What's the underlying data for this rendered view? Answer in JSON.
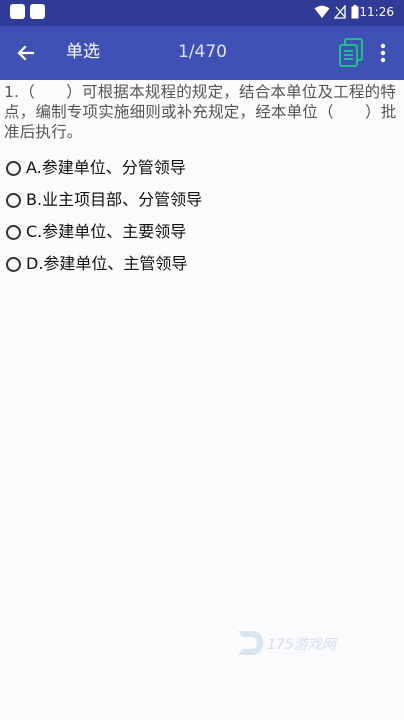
{
  "status_bar": {
    "time": "11:26"
  },
  "app_bar": {
    "title": "单选",
    "counter": "1/470"
  },
  "question": {
    "text": "1.（　　）可根据本规程的规定，结合本单位及工程的特点，编制专项实施细则或补充规定，经本单位（　　）批准后执行。"
  },
  "options": [
    {
      "label": "A.参建单位、分管领导"
    },
    {
      "label": "B.业主项目部、分管领导"
    },
    {
      "label": "C.参建单位、主要领导"
    },
    {
      "label": "D.参建单位、主管领导"
    }
  ],
  "watermark": {
    "text": "175游戏网"
  },
  "colors": {
    "app_bar": "#3f51b5",
    "status_bar": "#303b97",
    "copy_icon": "#1fc08a"
  }
}
